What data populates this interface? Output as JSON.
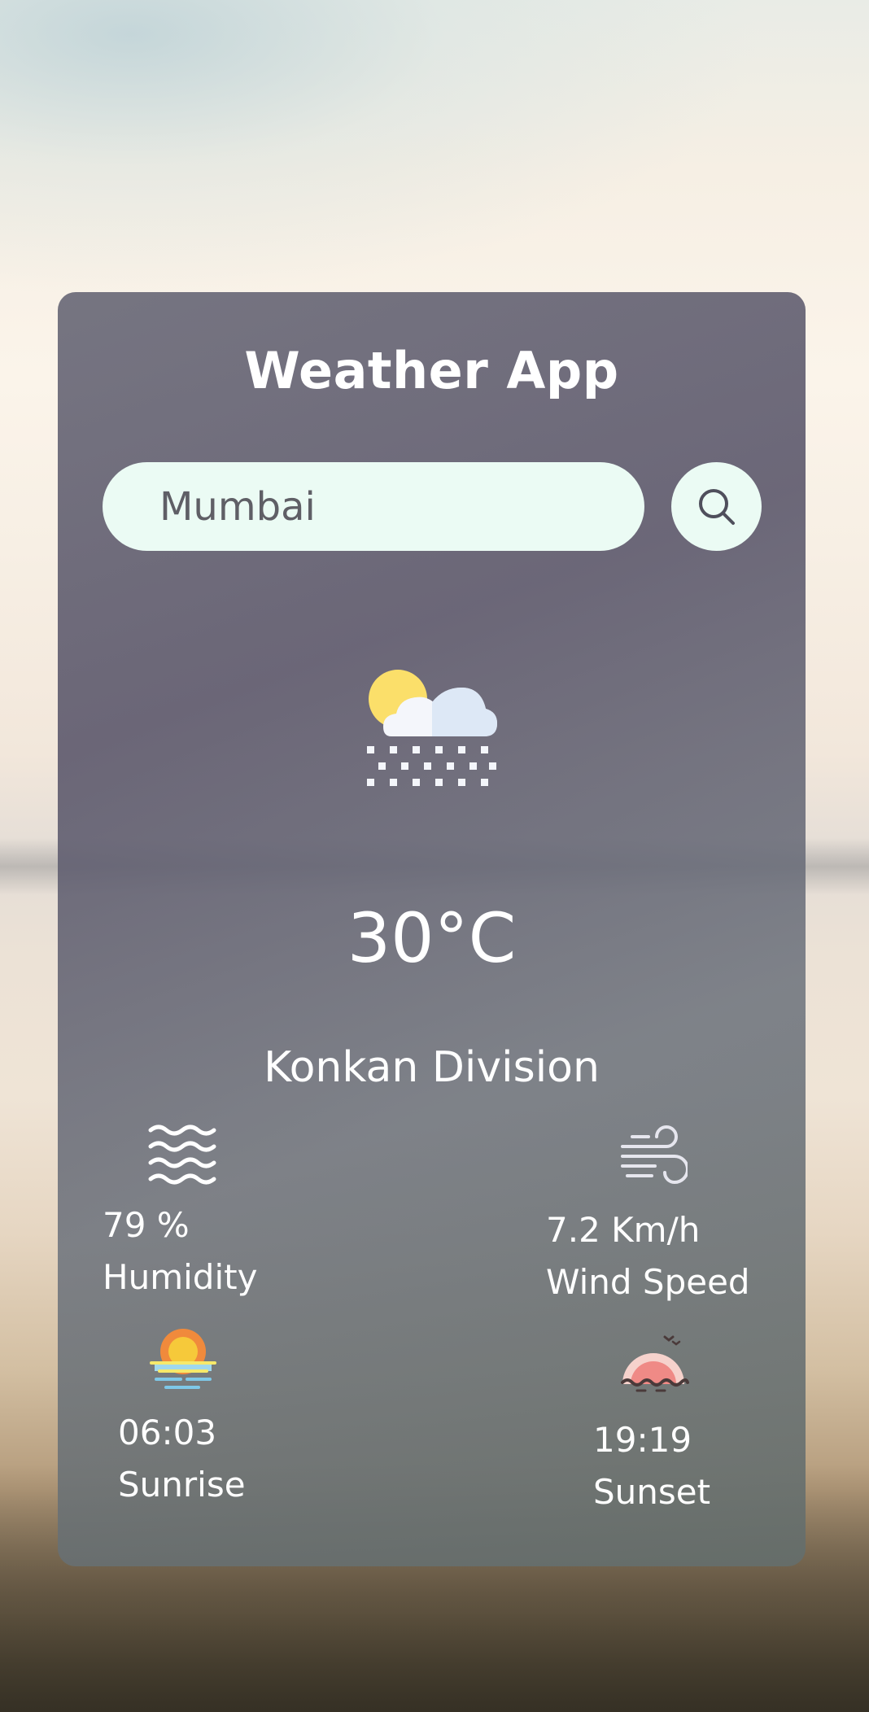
{
  "app": {
    "title": "Weather App"
  },
  "search": {
    "value": "Mumbai"
  },
  "current": {
    "condition_icon": "sun-cloud-snow-icon",
    "temperature": "30°C",
    "location": "Konkan Division"
  },
  "stats": {
    "humidity": {
      "value": "79 %",
      "label": "Humidity",
      "icon": "waves-icon"
    },
    "wind": {
      "value": "7.2 Km/h",
      "label": "Wind Speed",
      "icon": "wind-icon"
    },
    "sunrise": {
      "value": "06:03",
      "label": "Sunrise",
      "icon": "sunrise-icon"
    },
    "sunset": {
      "value": "19:19",
      "label": "Sunset",
      "icon": "sunset-icon"
    }
  },
  "colors": {
    "card_bg": "#646474",
    "input_bg": "#ebfbf4",
    "text": "#ffffff",
    "input_text": "#5f5f66"
  }
}
